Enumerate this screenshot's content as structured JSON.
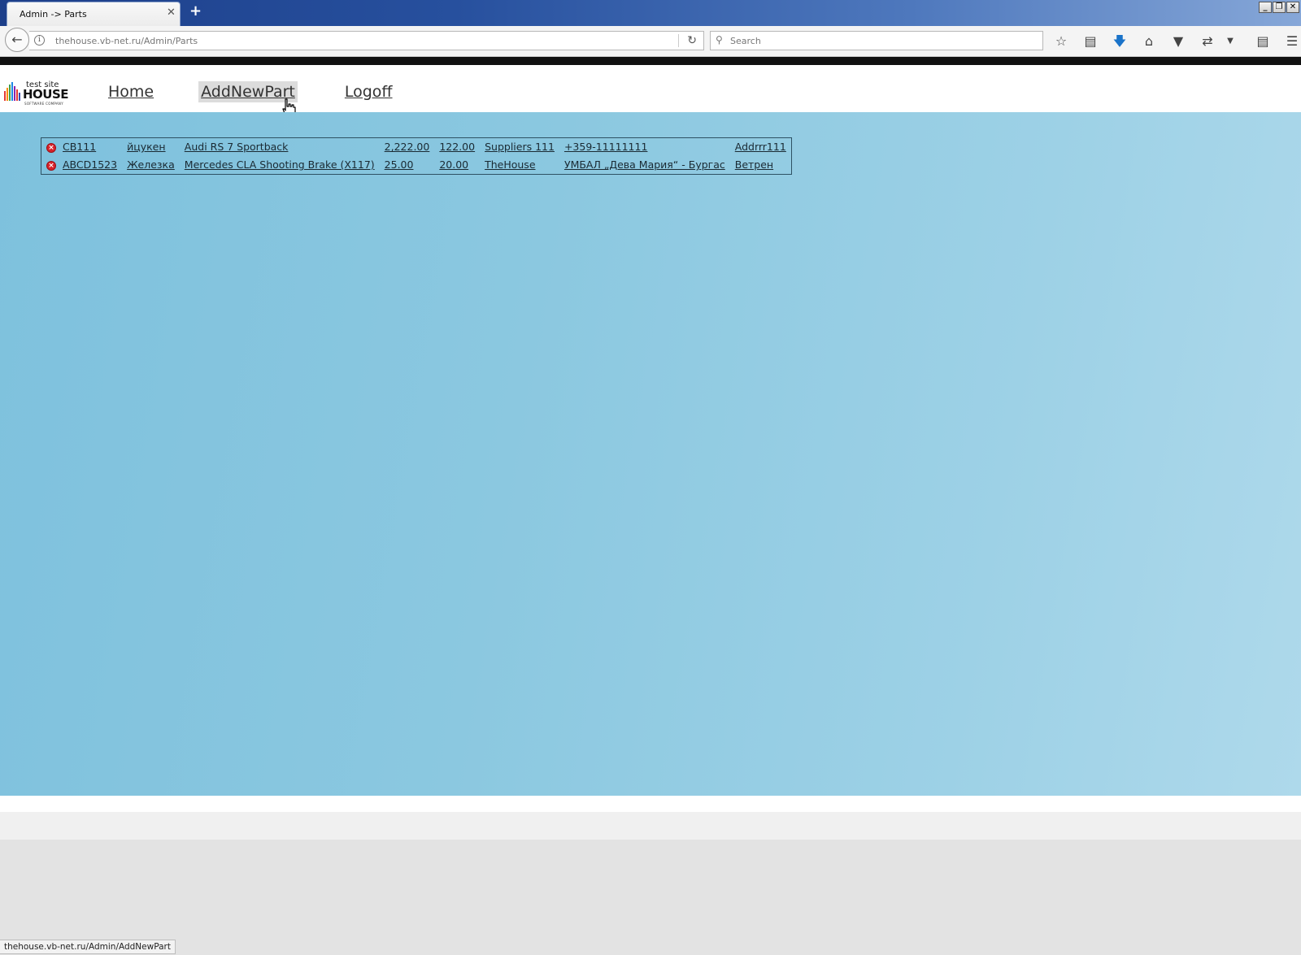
{
  "browser": {
    "tab_title": "Admin -> Parts",
    "tab_close_glyph": "✕",
    "new_tab_glyph": "+",
    "url": "thehouse.vb-net.ru/Admin/Parts",
    "search_placeholder": "Search",
    "status_url": "thehouse.vb-net.ru/Admin/AddNewPart"
  },
  "logo": {
    "top": "test site",
    "main": "HOUSE",
    "sub": "SOFTWARE COMPANY"
  },
  "menu": {
    "home": "Home",
    "add_new_part": "AddNewPart",
    "logoff": "Logoff"
  },
  "parts": [
    {
      "code": "CB111",
      "category": "йцукен",
      "model": "Audi RS 7 Sportback",
      "price": "2,222.00",
      "cost": "122.00",
      "supplier": "Suppliers 111",
      "phone": "+359-11111111",
      "address": "Addrrr111"
    },
    {
      "code": "ABCD1523",
      "category": "Железка",
      "model": "Mercedes CLA Shooting Brake (X117)",
      "price": "25.00",
      "cost": "20.00",
      "supplier": "TheHouse",
      "phone": "УМБАЛ „Дева Мария“ - Бургас",
      "address": "Ветрен"
    }
  ],
  "colors": {
    "content_bg": "#8bc8e0",
    "delete_icon": "#d8232a",
    "table_border": "#2e5163"
  }
}
